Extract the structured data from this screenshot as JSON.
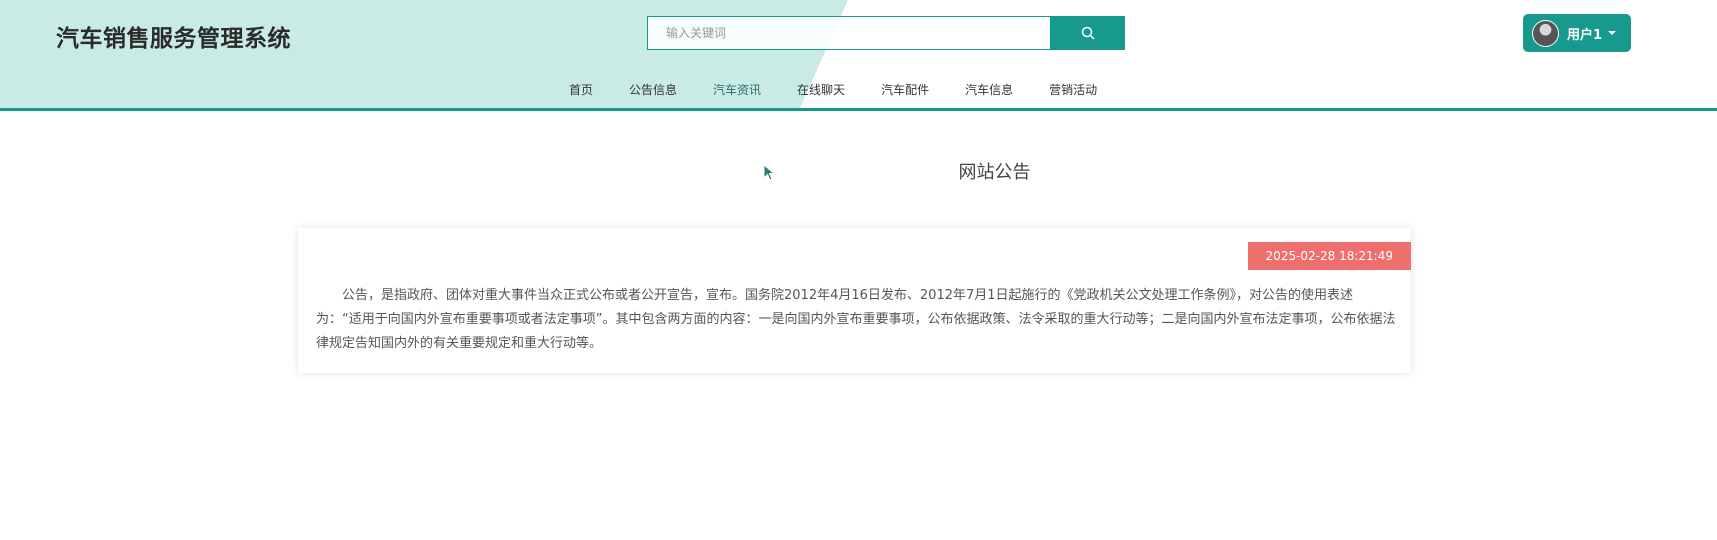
{
  "header": {
    "site_title": "汽车销售服务管理系统",
    "search": {
      "placeholder": "输入关键词",
      "button_icon": "search-icon"
    },
    "user": {
      "name": "用户1",
      "avatar_icon": "avatar"
    }
  },
  "nav": {
    "items": [
      {
        "label": "首页",
        "active": false
      },
      {
        "label": "公告信息",
        "active": false
      },
      {
        "label": "汽车资讯",
        "active": true
      },
      {
        "label": "在线聊天",
        "active": false
      },
      {
        "label": "汽车配件",
        "active": false
      },
      {
        "label": "汽车信息",
        "active": false
      },
      {
        "label": "营销活动",
        "active": false
      }
    ]
  },
  "main": {
    "section_title": "网站公告",
    "announcement": {
      "date": "2025-02-28 18:21:49",
      "content": "公告，是指政府、团体对重大事件当众正式公布或者公开宣告，宣布。国务院2012年4月16日发布、2012年7月1日起施行的《党政机关公文处理工作条例》，对公告的使用表述为：“适用于向国内外宣布重要事项或者法定事项”。其中包含两方面的内容：一是向国内外宣布重要事项，公布依据政策、法令采取的重大行动等；二是向国内外宣布法定事项，公布依据法律规定告知国内外的有关重要规定和重大行动等。"
    }
  },
  "colors": {
    "accent": "#17998d",
    "header_bg": "#c8ebe6",
    "active_tab": "#6ccbc3",
    "date_badge": "#ef6f6c"
  }
}
